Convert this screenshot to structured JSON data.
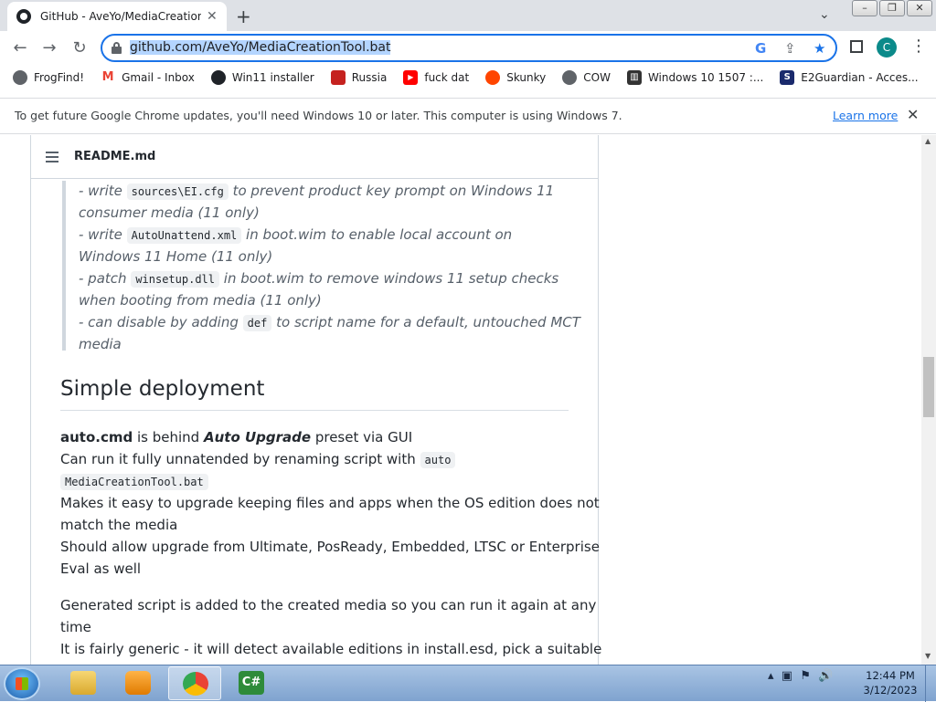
{
  "browser": {
    "tab_title": "GitHub - AveYo/MediaCreationTool.bat",
    "tab_close": "✕",
    "new_tab": "+",
    "url": "github.com/AveYo/MediaCreationTool.bat",
    "avatar_letter": "C",
    "accent_color": "#1a73e8"
  },
  "bookmarks": [
    {
      "label": "FrogFind!",
      "icon": "globe-icon",
      "color": "#5f6368"
    },
    {
      "label": "Gmail - Inbox",
      "icon": "gmail-icon",
      "color": "#ea4335"
    },
    {
      "label": "Win11 installer",
      "icon": "github-icon",
      "color": "#1f2328"
    },
    {
      "label": "Russia",
      "icon": "bookmark-icon",
      "color": "#c5221f"
    },
    {
      "label": "fuck dat",
      "icon": "youtube-icon",
      "color": "#ff0000"
    },
    {
      "label": "Skunky",
      "icon": "reddit-icon",
      "color": "#ff4500"
    },
    {
      "label": "COW",
      "icon": "globe-icon",
      "color": "#5f6368"
    },
    {
      "label": "Windows 10 1507 :...",
      "icon": "archive-icon",
      "color": "#333333"
    },
    {
      "label": "E2Guardian - Acces...",
      "icon": "e2-icon",
      "color": "#1a2a6c"
    }
  ],
  "infobar": {
    "message": "To get future Google Chrome updates, you'll need Windows 10 or later. This computer is using Windows 7.",
    "link": "Learn more"
  },
  "readme": {
    "file_name": "README.md",
    "quote": {
      "l1_pre": "- write ",
      "l1_code": "sources\\EI.cfg",
      "l1_post": " to prevent product key prompt on Windows 11",
      "l2": "consumer media (11 only)",
      "l3_pre": "- write ",
      "l3_code": "AutoUnattend.xml",
      "l3_post": " in boot.wim to enable local account on",
      "l4": "Windows 11 Home (11 only)",
      "l5_pre": "- patch ",
      "l5_code": "winsetup.dll",
      "l5_post": " in boot.wim to remove windows 11 setup checks",
      "l6": "when booting from media (11 only)",
      "l7_pre": "- can disable by adding ",
      "l7_code": "def",
      "l7_post": " to script name for a default, untouched MCT",
      "l8": "media"
    },
    "heading": "Simple deployment",
    "p": {
      "a_bold": "auto.cmd",
      "a_mid": " is behind ",
      "a_strong_em": "Auto Upgrade",
      "a_post": " preset via GUI",
      "b_pre": "Can run it fully unnatended by renaming script with ",
      "b_code": "auto",
      "c_code": "MediaCreationTool.bat",
      "d": "Makes it easy to upgrade keeping files and apps when the OS edition does not",
      "e": "match the media",
      "f": "Should allow upgrade from Ultimate, PosReady, Embedded, LTSC or Enterprise",
      "g": "Eval as well",
      "h": "Generated script is added to the created media so you can run it again at any",
      "i": "time",
      "j": "It is fairly generic - it will detect available editions in install.esd, pick a suitable"
    }
  },
  "taskbar": {
    "time": "12:44 PM",
    "date": "3/12/2023",
    "apps": [
      "explorer-icon",
      "media-player-icon",
      "chrome-icon",
      "csharp-icon"
    ]
  }
}
